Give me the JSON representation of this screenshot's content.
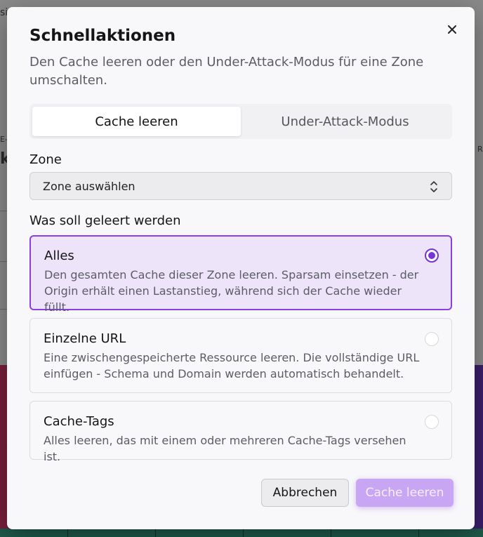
{
  "background": {
    "fragments": [
      "si",
      "E-",
      "k",
      "R"
    ]
  },
  "modal": {
    "title": "Schnellaktionen",
    "subtitle": "Den Cache leeren oder den Under-Attack-Modus für eine Zone umschalten.",
    "close_icon": "close-icon",
    "tabs": [
      {
        "label": "Cache leeren",
        "active": true
      },
      {
        "label": "Under-Attack-Modus",
        "active": false
      }
    ],
    "zone": {
      "label": "Zone",
      "placeholder": "Zone auswählen",
      "icon": "chevron-up-down-icon"
    },
    "purge": {
      "label": "Was soll geleert werden",
      "options": [
        {
          "title": "Alles",
          "description": "Den gesamten Cache dieser Zone leeren. Sparsam einsetzen - der Origin erhält einen Lastanstieg, während sich der Cache wieder füllt.",
          "selected": true
        },
        {
          "title": "Einzelne URL",
          "description": "Eine zwischengespeicherte Ressource leeren. Die vollständige URL einfügen - Schema und Domain werden automatisch behandelt.",
          "selected": false
        },
        {
          "title": "Cache-Tags",
          "description": "Alles leeren, das mit einem oder mehreren Cache-Tags versehen ist.",
          "selected": false
        }
      ]
    },
    "footer": {
      "cancel_label": "Abbrechen",
      "submit_label": "Cache leeren"
    },
    "colors": {
      "accent": "#7a33d6",
      "selected_bg": "#ede4fa",
      "primary_disabled": "#c9a6f4"
    }
  }
}
